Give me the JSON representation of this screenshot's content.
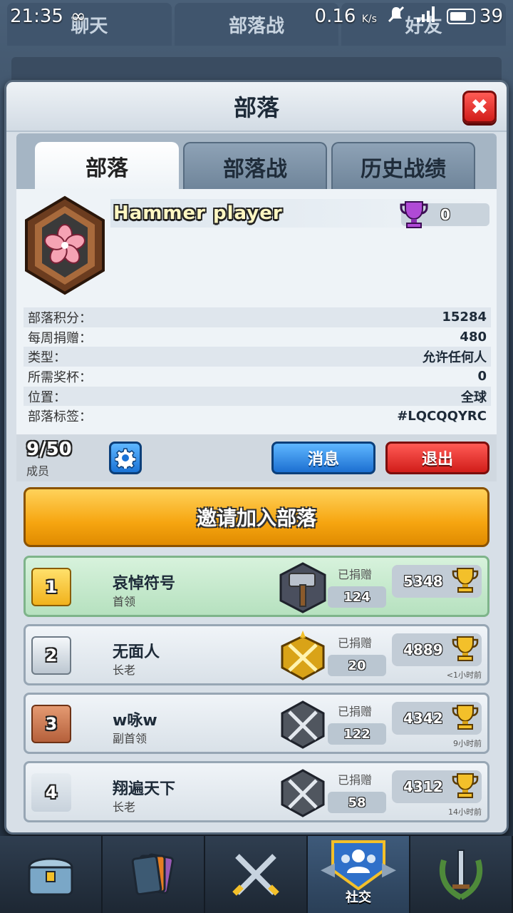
{
  "status_bar": {
    "time": "21:35",
    "speed": "0.16",
    "speed_unit": "K/s",
    "battery": "39"
  },
  "background_tabs": [
    "聊天",
    "部落战",
    "好友"
  ],
  "dialog": {
    "title": "部落",
    "close_label": "✖"
  },
  "tabs": [
    {
      "label": "部落"
    },
    {
      "label": "部落战"
    },
    {
      "label": "历史战绩"
    }
  ],
  "clan": {
    "name": "Hammer player",
    "trophies": "0",
    "stats": [
      {
        "label": "部落积分：",
        "value": "15284"
      },
      {
        "label": "每周捐赠：",
        "value": "480"
      },
      {
        "label": "类型：",
        "value": "允许任何人"
      },
      {
        "label": "所需奖杯：",
        "value": "0"
      },
      {
        "label": "位置：",
        "value": "全球"
      },
      {
        "label": "部落标签：",
        "value": "#LQCQQYRC"
      }
    ]
  },
  "members_bar": {
    "count": "9/50",
    "label": "成员",
    "message_button": "消息",
    "leave_button": "退出"
  },
  "invite_button": "邀请加入部落",
  "members": [
    {
      "rank": "1",
      "name": "哀悼符号",
      "role": "首领",
      "donated_label": "已捐赠",
      "donated": "124",
      "trophies": "5348",
      "last_seen": ""
    },
    {
      "rank": "2",
      "name": "无面人",
      "role": "长老",
      "donated_label": "已捐赠",
      "donated": "20",
      "trophies": "4889",
      "last_seen": "<1小时前"
    },
    {
      "rank": "3",
      "name": "w咏w",
      "role": "副首领",
      "donated_label": "已捐赠",
      "donated": "122",
      "trophies": "4342",
      "last_seen": "9小时前"
    },
    {
      "rank": "4",
      "name": "翔遍天下",
      "role": "长老",
      "donated_label": "已捐赠",
      "donated": "58",
      "trophies": "4312",
      "last_seen": "14小时前"
    }
  ],
  "bottom_nav": {
    "active_label": "社交"
  },
  "colors": {
    "accent_orange": "#f6a510",
    "blue_button": "#1c6fd1",
    "red_button": "#d11d1a"
  }
}
